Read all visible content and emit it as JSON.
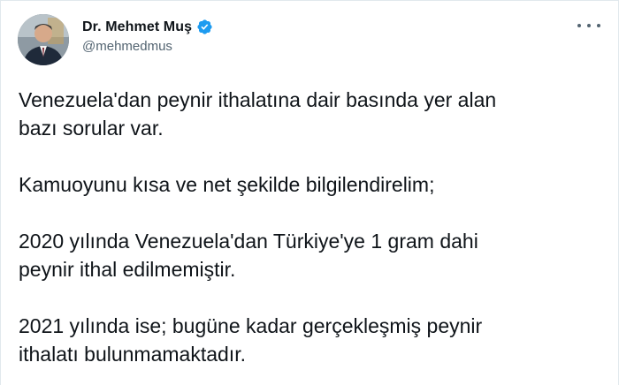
{
  "author": {
    "name": "Dr. Mehmet Muş",
    "handle": "@mehmedmus",
    "verified": true,
    "verified_color": "#1d9bf0"
  },
  "tweet": {
    "paragraphs": [
      "Venezuela'dan peynir ithalatına dair basında yer alan\nbazı sorular var.",
      "Kamuoyunu kısa ve net şekilde bilgilendirelim;",
      "2020 yılında Venezuela'dan Türkiye'ye 1 gram dahi\npeynir ithal edilmemiştir.",
      "2021 yılında ise; bugüne kadar gerçekleşmiş peynir\nithalatı bulunmamaktadır."
    ]
  },
  "icons": {
    "avatar": "profile-photo",
    "verified": "verified-badge-icon",
    "more": "more-options-icon"
  }
}
